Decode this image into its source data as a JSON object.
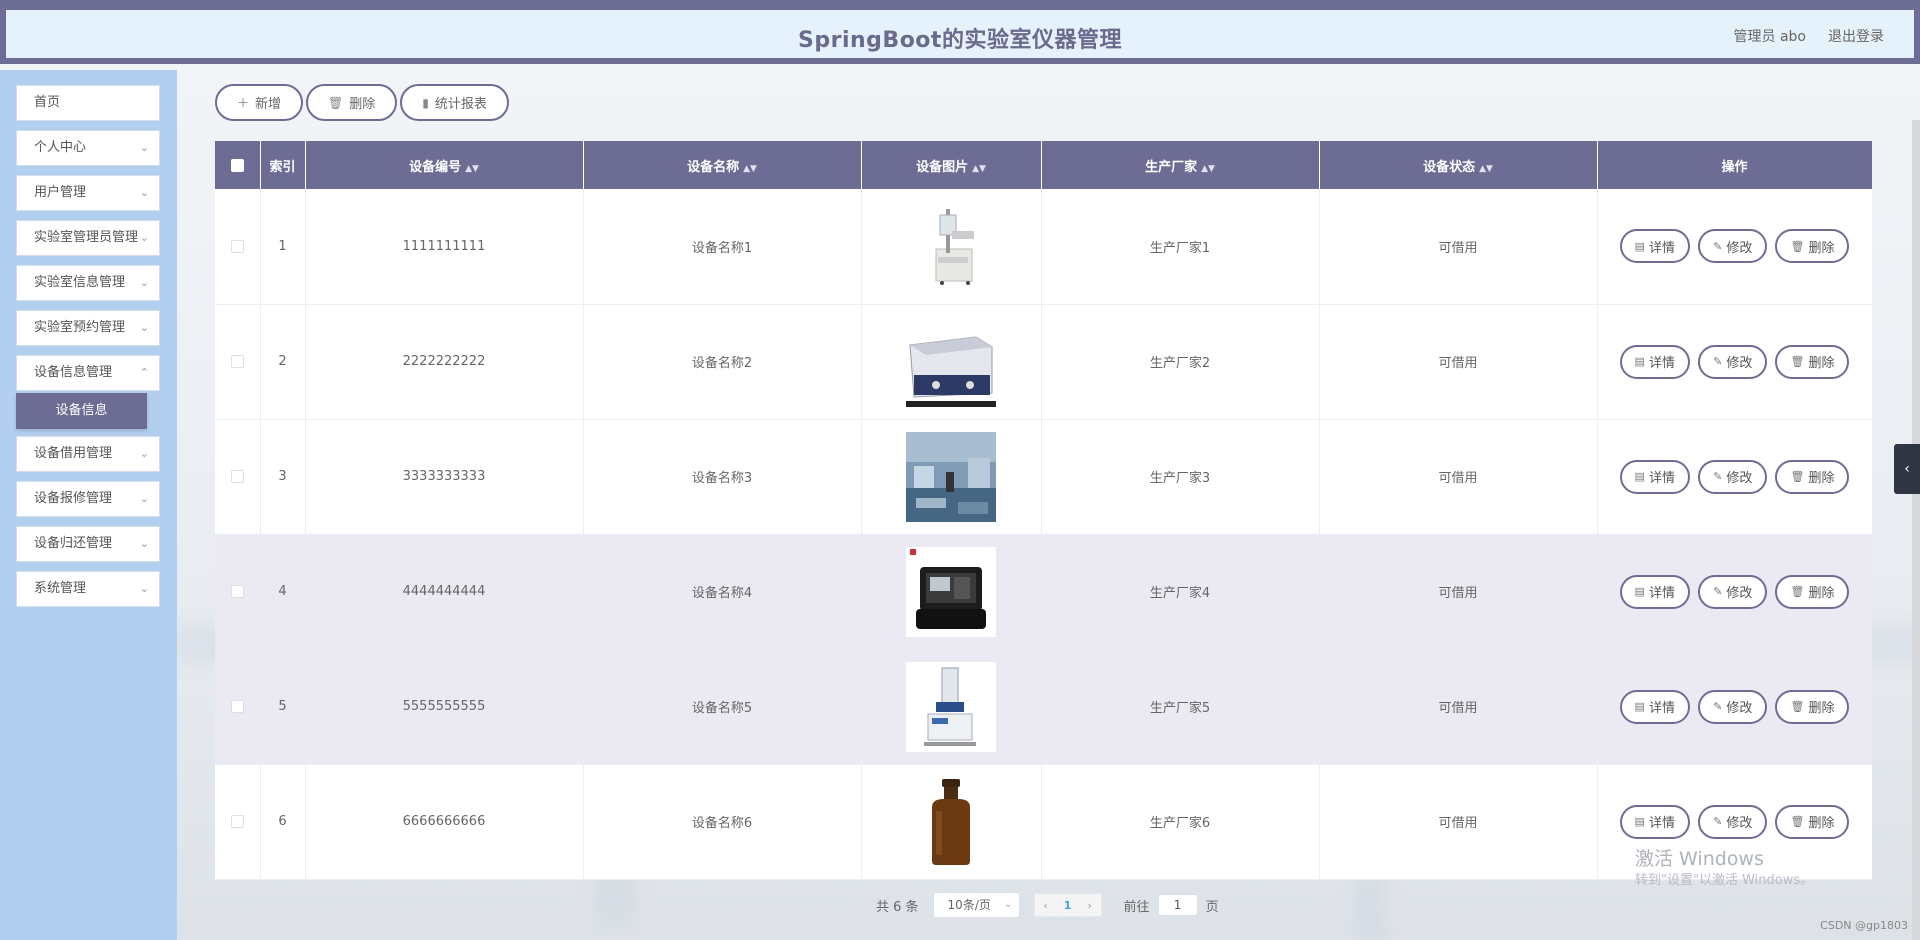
{
  "header": {
    "title": "SpringBoot的实验室仪器管理",
    "user_label": "管理员 abo",
    "logout_label": "退出登录"
  },
  "sidebar": {
    "items": [
      {
        "label": "首页",
        "has_children": false
      },
      {
        "label": "个人中心",
        "has_children": true
      },
      {
        "label": "用户管理",
        "has_children": true
      },
      {
        "label": "实验室管理员管理",
        "has_children": true
      },
      {
        "label": "实验室信息管理",
        "has_children": true
      },
      {
        "label": "实验室预约管理",
        "has_children": true
      },
      {
        "label": "设备信息管理",
        "has_children": true
      },
      {
        "label": "设备借用管理",
        "has_children": true
      },
      {
        "label": "设备报修管理",
        "has_children": true
      },
      {
        "label": "设备归还管理",
        "has_children": true
      },
      {
        "label": "系统管理",
        "has_children": true
      }
    ],
    "active_sub_item": "设备信息"
  },
  "toolbar": {
    "add_label": "新增",
    "delete_label": "删除",
    "report_label": "统计报表"
  },
  "table": {
    "columns": [
      "索引",
      "设备编号",
      "设备名称",
      "设备图片",
      "生产厂家",
      "设备状态",
      "操作"
    ],
    "rows": [
      {
        "index": "1",
        "code": "1111111111",
        "name": "设备名称1",
        "image": "instrument-stand",
        "maker": "生产厂家1",
        "status": "可借用"
      },
      {
        "index": "2",
        "code": "2222222222",
        "name": "设备名称2",
        "image": "ultrasonic-cleaner",
        "maker": "生产厂家2",
        "status": "可借用"
      },
      {
        "index": "3",
        "code": "3333333333",
        "name": "设备名称3",
        "image": "lab-room",
        "maker": "生产厂家3",
        "status": "可借用"
      },
      {
        "index": "4",
        "code": "4444444444",
        "name": "设备名称4",
        "image": "portable-kit",
        "maker": "生产厂家4",
        "status": "可借用"
      },
      {
        "index": "5",
        "code": "5555555555",
        "name": "设备名称5",
        "image": "freeze-dryer",
        "maker": "生产厂家5",
        "status": "可借用"
      },
      {
        "index": "6",
        "code": "6666666666",
        "name": "设备名称6",
        "image": "amber-bottle",
        "maker": "生产厂家6",
        "status": "可借用"
      }
    ],
    "row_actions": {
      "detail": "详情",
      "edit": "修改",
      "delete": "删除"
    }
  },
  "pagination": {
    "total_text": "共 6 条",
    "page_size": "10条/页",
    "current_page": "1",
    "goto_label": "前往",
    "goto_value": "1",
    "page_unit": "页"
  },
  "overlay": {
    "watermark_title": "激活 Windows",
    "watermark_sub": "转到\"设置\"以激活 Windows。",
    "credit": "CSDN @gp1803"
  }
}
